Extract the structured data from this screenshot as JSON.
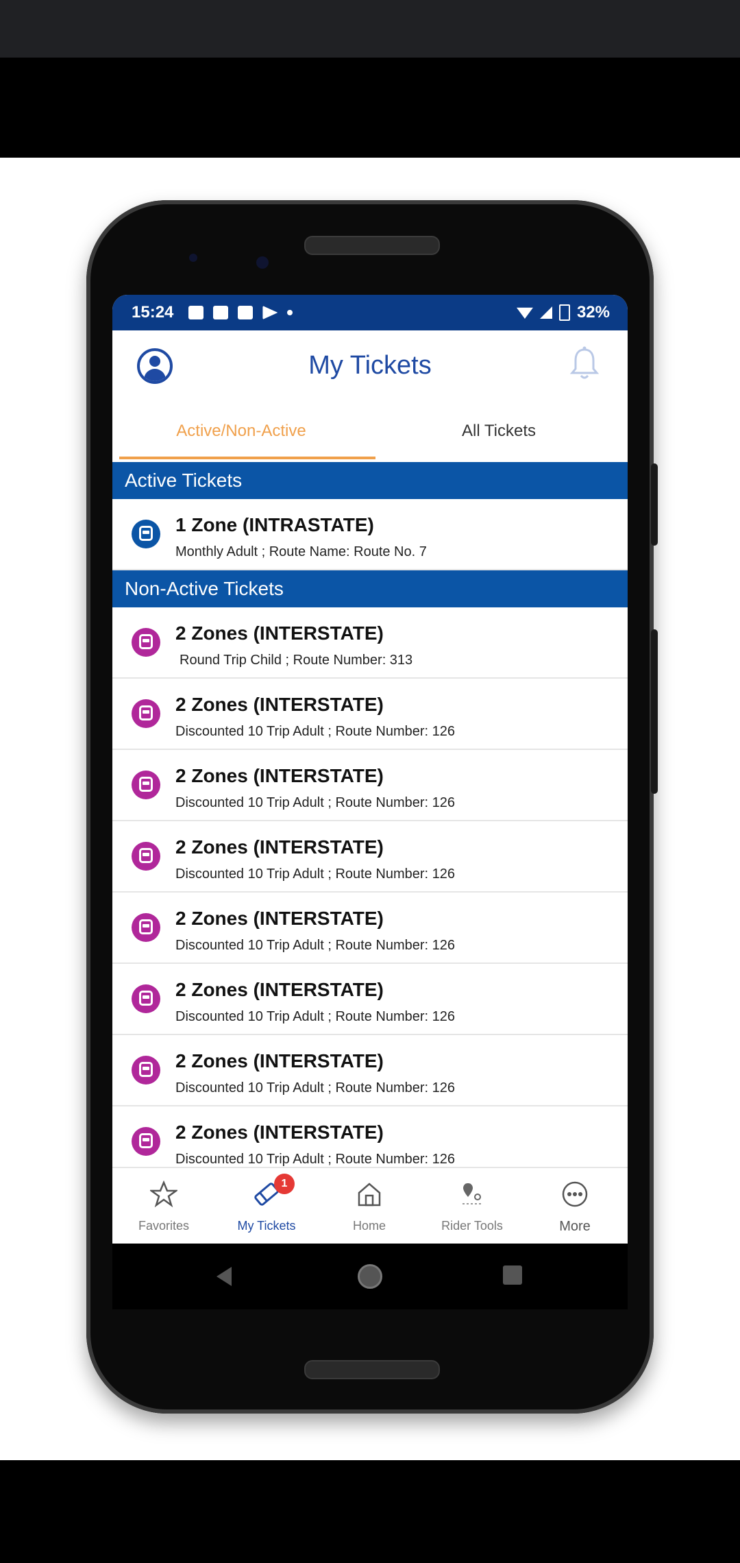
{
  "status_bar": {
    "time": "15:24",
    "battery": "32%"
  },
  "header": {
    "title": "My Tickets"
  },
  "tabs": [
    {
      "label": "Active/Non-Active",
      "selected": true
    },
    {
      "label": "All Tickets",
      "selected": false
    }
  ],
  "active_section": {
    "title": "Active Tickets",
    "items": [
      {
        "title": "1 Zone (INTRASTATE)",
        "subtitle": "Monthly Adult ; Route Name: Route No. 7",
        "icon": "bus-icon"
      }
    ]
  },
  "nonactive_section": {
    "title": "Non-Active Tickets",
    "items": [
      {
        "title": "2 Zones (INTERSTATE)",
        "subtitle": "Round Trip Child ; Route Number: 313",
        "icon": "bus-icon"
      },
      {
        "title": "2 Zones (INTERSTATE)",
        "subtitle": "Discounted 10 Trip Adult ; Route Number: 126",
        "icon": "bus-icon"
      },
      {
        "title": "2 Zones (INTERSTATE)",
        "subtitle": "Discounted 10 Trip Adult ; Route Number: 126",
        "icon": "bus-icon"
      },
      {
        "title": "2 Zones (INTERSTATE)",
        "subtitle": "Discounted 10 Trip Adult ; Route Number: 126",
        "icon": "bus-icon"
      },
      {
        "title": "2 Zones (INTERSTATE)",
        "subtitle": "Discounted 10 Trip Adult ; Route Number: 126",
        "icon": "bus-icon"
      },
      {
        "title": "2 Zones (INTERSTATE)",
        "subtitle": "Discounted 10 Trip Adult ; Route Number: 126",
        "icon": "bus-icon"
      },
      {
        "title": "2 Zones (INTERSTATE)",
        "subtitle": "Discounted 10 Trip Adult ; Route Number: 126",
        "icon": "bus-icon"
      },
      {
        "title": "2 Zones (INTERSTATE)",
        "subtitle": "Discounted 10 Trip Adult ; Route Number: 126",
        "icon": "bus-icon"
      }
    ]
  },
  "bottom_nav": [
    {
      "label": "Favorites",
      "icon": "star-icon"
    },
    {
      "label": "My Tickets",
      "icon": "ticket-icon",
      "badge": "1"
    },
    {
      "label": "Home",
      "icon": "home-icon"
    },
    {
      "label": "Rider Tools",
      "icon": "map-pin-icon"
    },
    {
      "label": "More",
      "icon": "more-icon"
    }
  ],
  "colors": {
    "status_bar": "#0b3b86",
    "section_header": "#0b55a6",
    "title_blue": "#1f4aa3",
    "tab_accent": "#f0a04b",
    "active_ticket_icon": "#0b55a6",
    "nonactive_ticket_icon": "#b0279a",
    "badge": "#e53935"
  }
}
